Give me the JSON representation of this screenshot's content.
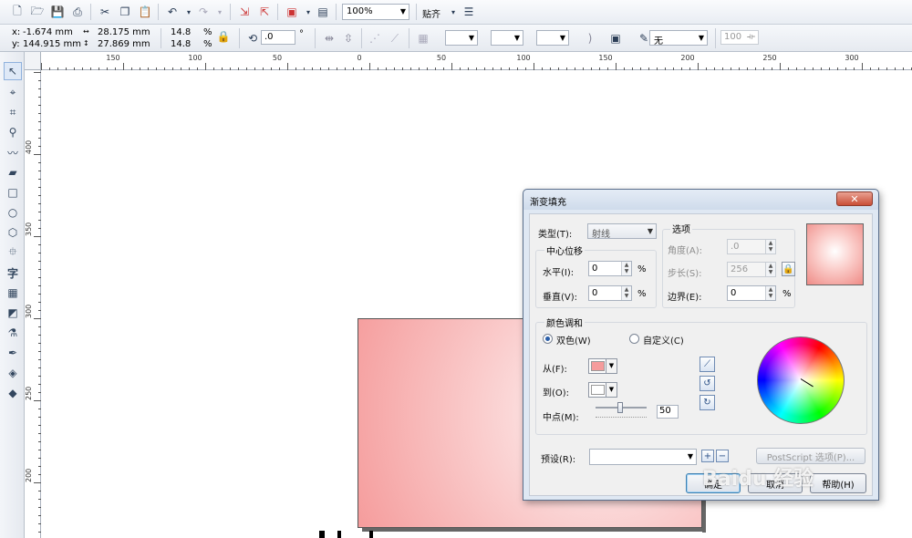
{
  "toolbar": {
    "zoom": "100%",
    "snap_label": "贴齐"
  },
  "propbar": {
    "x_label": "x:",
    "x_value": "-1.674 mm",
    "y_label": "y:",
    "y_value": "144.915 mm",
    "width_value": "28.175 mm",
    "height_value": "27.869 mm",
    "scale_w": "14.8",
    "scale_h": "14.8",
    "pct": "%",
    "rotation": ".0",
    "degree": "°",
    "outline_value": "无",
    "percent_value": "100"
  },
  "ruler": {
    "h_labels": [
      "150",
      "100",
      "50",
      "0",
      "50",
      "100",
      "150",
      "200",
      "250",
      "300"
    ],
    "v_labels": [
      "400",
      "350",
      "300",
      "250",
      "200"
    ]
  },
  "dialog": {
    "title": "渐变填充",
    "close": "✕",
    "type_label": "类型(T):",
    "type_value": "射线",
    "options_group": "选项",
    "center_group": "中心位移",
    "horizontal_label": "水平(I):",
    "horizontal_value": "0",
    "vertical_label": "垂直(V):",
    "vertical_value": "0",
    "angle_label": "角度(A):",
    "angle_value": ".0",
    "steps_label": "步长(S):",
    "steps_value": "256",
    "edge_label": "边界(E):",
    "edge_value": "0",
    "pct": "%",
    "blend_group": "颜色调和",
    "two_color_label": "双色(W)",
    "custom_label": "自定义(C)",
    "from_label": "从(F):",
    "to_label": "到(O):",
    "midpoint_label": "中点(M):",
    "midpoint_value": "50",
    "preset_label": "预设(R):",
    "postscript_label": "PostScript 选项(P)...",
    "ok_label": "确定",
    "cancel_label": "取消",
    "help_label": "帮助(H)"
  },
  "colors": {
    "from": "#f59c9c",
    "to": "#ffffff"
  },
  "watermark": "Baidu 经验"
}
